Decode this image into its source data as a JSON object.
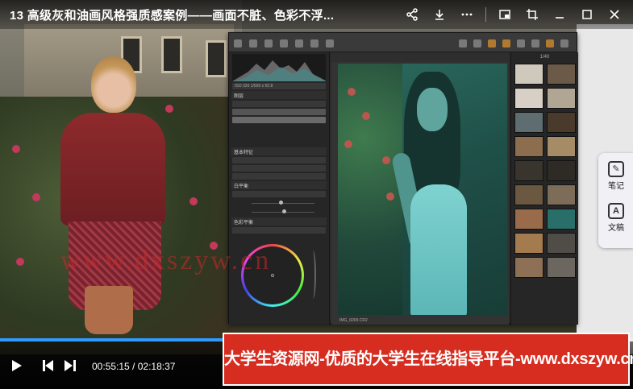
{
  "player": {
    "title": "13 高级灰和油画风格强质感案例——画面不脏、色彩不浮...",
    "current_time": "00:55:15",
    "total_time": "02:18:37",
    "time_separator": " / ",
    "progress": 0.398
  },
  "window_controls": {
    "share_icon": "share-icon",
    "download_icon": "download-icon",
    "pip_icon": "picture-in-picture-icon",
    "crop_icon": "crop-icon",
    "minimize_icon": "minimize-icon",
    "maximize_icon": "maximize-icon",
    "close_icon": "close-icon"
  },
  "watermark": "www.dxszyw.cn",
  "banner": {
    "text": "大学生资源网-优质的大学生在线指导平台-www.dxszyw.cn",
    "color": "#d62d20"
  },
  "side_panel": {
    "items": [
      {
        "label": "笔记",
        "icon": "note-icon"
      },
      {
        "label": "文稿",
        "icon": "document-icon"
      }
    ]
  },
  "capture_one": {
    "histogram_values": "ISO 320   1/500 s   f/2.8",
    "panel_layers": "图层",
    "panel_basic": "基本特征",
    "panel_white_balance": "白平衡",
    "panel_color_balance": "色彩平衡",
    "browser_count": "1/40",
    "filename": "IMG_6009.CR2"
  },
  "colors": {
    "progress": "#2e9bff",
    "banner": "#d62d20"
  }
}
